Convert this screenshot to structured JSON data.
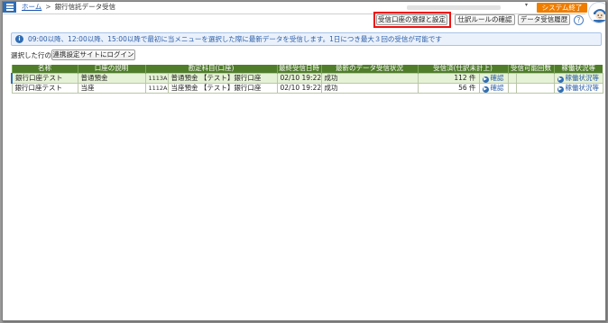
{
  "breadcrumb": {
    "home": "ホーム",
    "separator": ">",
    "current": "銀行信託データ受信"
  },
  "header": {
    "system_exit": "システム終了",
    "dropdown_glyph": "▾",
    "help_glyph": "?"
  },
  "toolbar": {
    "register_settings": "受信口座の登録と設定",
    "journal_rules": "仕訳ルールの確認",
    "receive_history": "データ受信履歴"
  },
  "info": {
    "icon_glyph": "i",
    "message": "09:00以降、12:00以降、15:00以降で最初に当メニューを選択した際に最新データを受信します。1日につき最大３回の受信が可能です"
  },
  "selection": {
    "label": "選択した行の",
    "login_button": "連携設定サイトにログイン"
  },
  "table": {
    "columns": [
      "名称",
      "口座の説明",
      "勘定科目(口座)",
      "最終受信日時",
      "最新のデータ受信状況",
      "受信済(仕訳未計上)",
      "受信可能回数",
      "稼働状況等"
    ],
    "rows": [
      {
        "name": "銀行口座テスト",
        "description": "普通預金",
        "code": "1113A",
        "account": "普通預金 【テスト】銀行口座",
        "last_received": "02/10 19:22",
        "status": "成功",
        "received_count": "112 件",
        "confirm": "確認",
        "available": "",
        "operation": "稼働状況等"
      },
      {
        "name": "銀行口座テスト",
        "description": "当座",
        "code": "1112A",
        "account": "当座預金 【テスト】銀行口座",
        "last_received": "02/10 19:22",
        "status": "成功",
        "received_count": "56 件",
        "confirm": "確認",
        "available": "",
        "operation": "稼働状況等"
      }
    ]
  },
  "colors": {
    "accent": "#2f6db4",
    "table_header": "#4f7d2a",
    "system_exit": "#ef7d00",
    "highlight": "#e11111"
  }
}
